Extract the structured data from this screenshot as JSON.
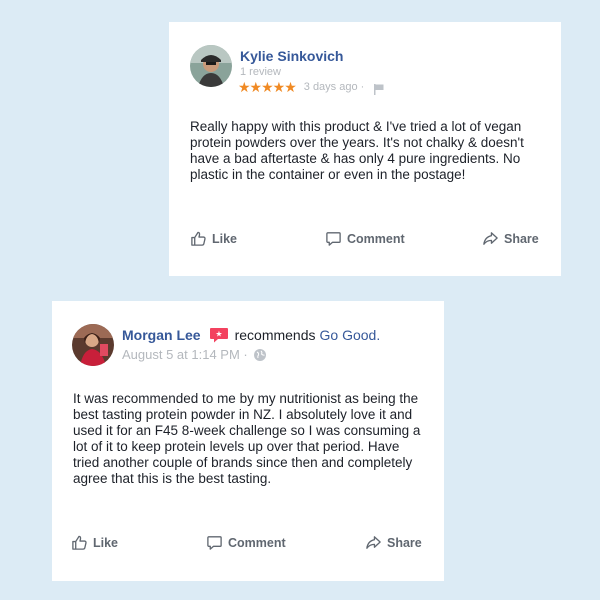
{
  "review1": {
    "author": "Kylie Sinkovich",
    "review_count": "1 review",
    "stars": "★★★★★",
    "time": "3 days ago ·",
    "body": "Really happy with this product & I've tried a lot of vegan protein powders over the years. It's not chalky & doesn't have a bad aftertaste & has only 4 pure ingredients. No plastic in the container or even in the postage!",
    "like_label": "Like",
    "comment_label": "Comment",
    "share_label": "Share"
  },
  "review2": {
    "author": "Morgan Lee",
    "recommends_text": "recommends",
    "page_name": "Go Good.",
    "date": "August 5 at 1:14 PM ·",
    "body": "It was recommended to me by my nutritionist as being the best tasting protein powder in NZ. I absolutely love it and used it for an F45 8-week challenge so I was consuming a lot of it to keep protein levels up over that period. Have tried another couple of brands since then and completely agree that this is the best tasting.",
    "like_label": "Like",
    "comment_label": "Comment",
    "share_label": "Share"
  },
  "colors": {
    "background": "#dcebf5",
    "name_link": "#365899",
    "star": "#f08a24",
    "recommend_badge": "#f3425f",
    "muted": "#b4b8bd",
    "action": "#606770"
  },
  "icons": [
    "avatar",
    "flag-icon",
    "recommend-icon",
    "globe-icon",
    "thumbs-up-icon",
    "comment-icon",
    "share-icon"
  ]
}
